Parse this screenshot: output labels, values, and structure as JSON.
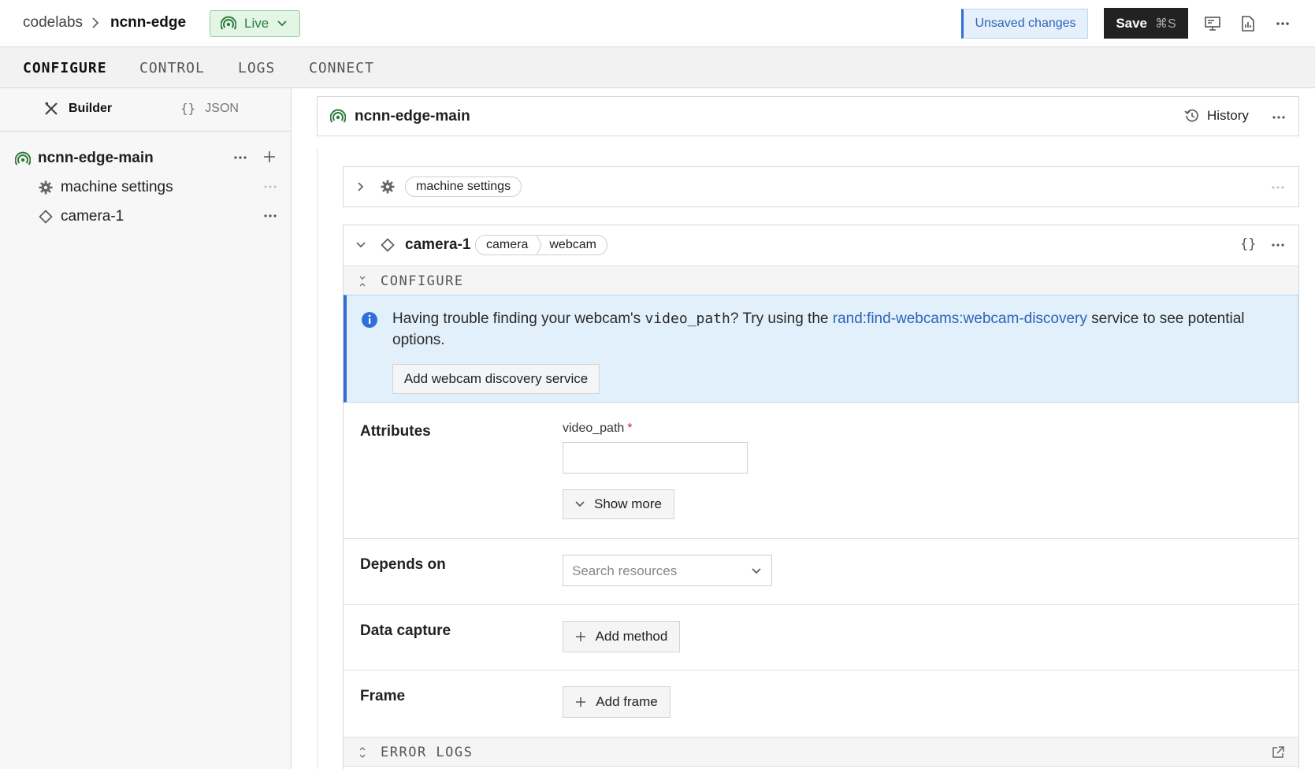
{
  "header": {
    "org": "codelabs",
    "machine": "ncnn-edge",
    "status": "Live",
    "unsaved": "Unsaved changes",
    "save_label": "Save",
    "save_shortcut": "⌘S"
  },
  "tabs": [
    "CONFIGURE",
    "CONTROL",
    "LOGS",
    "CONNECT"
  ],
  "sidebar": {
    "toggle": {
      "builder": "Builder",
      "json": "JSON"
    },
    "root": "ncnn-edge-main",
    "items": [
      {
        "label": "machine settings",
        "icon": "gear-icon"
      },
      {
        "label": "camera-1",
        "icon": "diamond-icon"
      }
    ]
  },
  "main": {
    "part_name": "ncnn-edge-main",
    "history": "History",
    "machine_settings_chip": "machine settings",
    "component": {
      "name": "camera-1",
      "api": "camera",
      "model": "webcam",
      "configure_section": "CONFIGURE",
      "info": {
        "pre": "Having trouble finding your webcam's",
        "code": "video_path",
        "mid": "? Try using the",
        "link": "rand:find-webcams:webcam-discovery",
        "post": "service to see potential options.",
        "button": "Add webcam discovery service"
      },
      "attributes": {
        "label": "Attributes",
        "field_label": "video_path",
        "required_mark": "*",
        "field_value": "",
        "show_more": "Show more"
      },
      "depends_on": {
        "label": "Depends on",
        "placeholder": "Search resources"
      },
      "data_capture": {
        "label": "Data capture",
        "button": "Add method"
      },
      "frame": {
        "label": "Frame",
        "button": "Add frame"
      },
      "error_logs": "ERROR LOGS"
    }
  },
  "colors": {
    "live_green": "#2d7a3a",
    "accent_blue": "#2f6fd6",
    "info_bg": "#e2f0fb",
    "save_bg": "#222222"
  }
}
